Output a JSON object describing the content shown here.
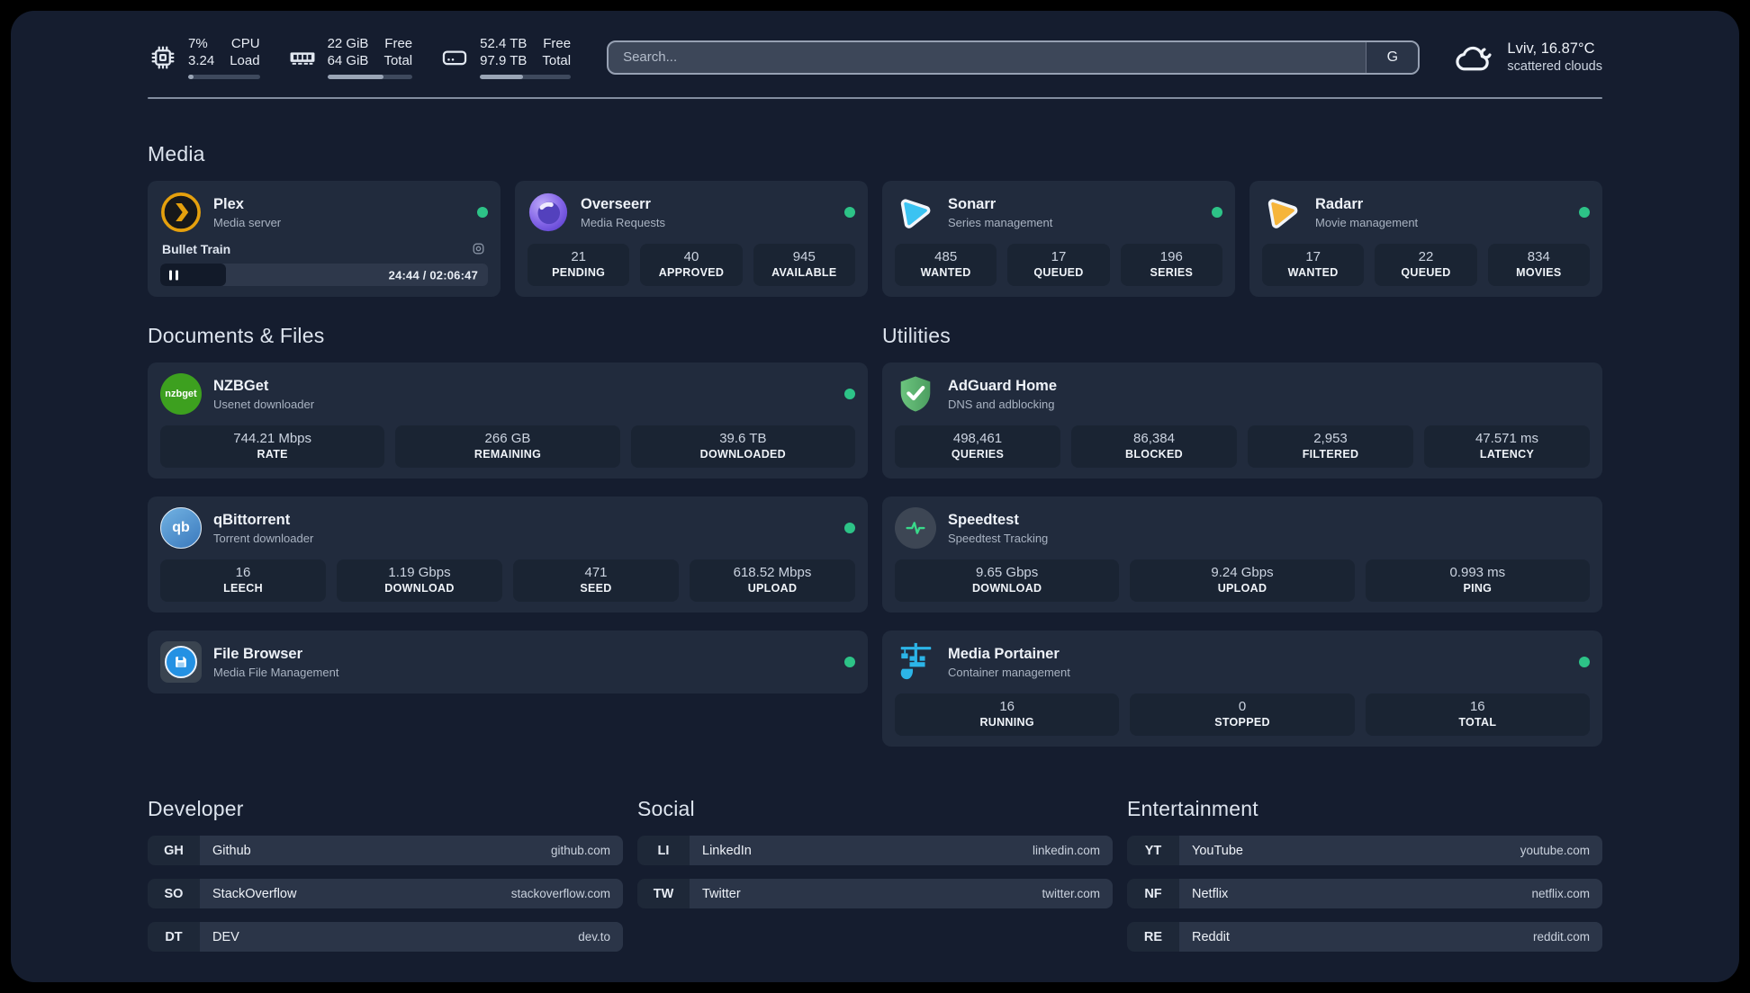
{
  "colors": {
    "status_online": "#2dc387",
    "accent_plex": "#e5a00d",
    "accent_overseerr": "#7c5ce0",
    "accent_sonarr": "#3bc3f2",
    "accent_radarr": "#f6b53b",
    "accent_nzbget": "#3da01f",
    "accent_qbittorrent": "#3a79bd",
    "accent_filebrowser": "#2491e3",
    "accent_adguard": "#5fba6e",
    "accent_speedtest": "#39d98a",
    "accent_portainer": "#2cb5e8"
  },
  "header": {
    "system_stats": [
      {
        "icon": "cpu-icon",
        "values": [
          "7%",
          "3.24"
        ],
        "labels": [
          "CPU",
          "Load"
        ],
        "progress_percent": 7
      },
      {
        "icon": "ram-icon",
        "values": [
          "22 GiB",
          "64 GiB"
        ],
        "labels": [
          "Free",
          "Total"
        ],
        "progress_percent": 66
      },
      {
        "icon": "disk-icon",
        "values": [
          "52.4 TB",
          "97.9 TB"
        ],
        "labels": [
          "Free",
          "Total"
        ],
        "progress_percent": 47
      }
    ],
    "search": {
      "placeholder": "Search...",
      "button_label": "G"
    },
    "weather": {
      "line1": "Lviv, 16.87°C",
      "line2": "scattered clouds"
    }
  },
  "icon_labels": {
    "nzbget": "nzbget",
    "qbittorrent": "qb"
  },
  "sections": {
    "media": {
      "title": "Media",
      "plex": {
        "name": "Plex",
        "description": "Media server",
        "online": true,
        "player": {
          "title": "Bullet Train",
          "time": "24:44 / 02:06:47",
          "progress_percent": 20
        }
      },
      "overseerr": {
        "name": "Overseerr",
        "description": "Media Requests",
        "online": true,
        "stats": [
          {
            "value": "21",
            "label": "PENDING"
          },
          {
            "value": "40",
            "label": "APPROVED"
          },
          {
            "value": "945",
            "label": "AVAILABLE"
          }
        ]
      },
      "sonarr": {
        "name": "Sonarr",
        "description": "Series management",
        "online": true,
        "stats": [
          {
            "value": "485",
            "label": "WANTED"
          },
          {
            "value": "17",
            "label": "QUEUED"
          },
          {
            "value": "196",
            "label": "SERIES"
          }
        ]
      },
      "radarr": {
        "name": "Radarr",
        "description": "Movie management",
        "online": true,
        "stats": [
          {
            "value": "17",
            "label": "WANTED"
          },
          {
            "value": "22",
            "label": "QUEUED"
          },
          {
            "value": "834",
            "label": "MOVIES"
          }
        ]
      }
    },
    "documents": {
      "title": "Documents & Files",
      "nzbget": {
        "name": "NZBGet",
        "description": "Usenet downloader",
        "online": true,
        "stats": [
          {
            "value": "744.21 Mbps",
            "label": "RATE"
          },
          {
            "value": "266 GB",
            "label": "REMAINING"
          },
          {
            "value": "39.6 TB",
            "label": "DOWNLOADED"
          }
        ]
      },
      "qbittorrent": {
        "name": "qBittorrent",
        "description": "Torrent downloader",
        "online": true,
        "stats": [
          {
            "value": "16",
            "label": "LEECH"
          },
          {
            "value": "1.19 Gbps",
            "label": "DOWNLOAD"
          },
          {
            "value": "471",
            "label": "SEED"
          },
          {
            "value": "618.52 Mbps",
            "label": "UPLOAD"
          }
        ]
      },
      "filebrowser": {
        "name": "File Browser",
        "description": "Media File Management",
        "online": true
      }
    },
    "utilities": {
      "title": "Utilities",
      "adguard": {
        "name": "AdGuard Home",
        "description": "DNS and adblocking",
        "stats": [
          {
            "value": "498,461",
            "label": "QUERIES"
          },
          {
            "value": "86,384",
            "label": "BLOCKED"
          },
          {
            "value": "2,953",
            "label": "FILTERED"
          },
          {
            "value": "47.571 ms",
            "label": "LATENCY"
          }
        ]
      },
      "speedtest": {
        "name": "Speedtest",
        "description": "Speedtest Tracking",
        "stats": [
          {
            "value": "9.65 Gbps",
            "label": "DOWNLOAD"
          },
          {
            "value": "9.24 Gbps",
            "label": "UPLOAD"
          },
          {
            "value": "0.993 ms",
            "label": "PING"
          }
        ]
      },
      "portainer": {
        "name": "Media Portainer",
        "description": "Container management",
        "online": true,
        "stats": [
          {
            "value": "16",
            "label": "RUNNING"
          },
          {
            "value": "0",
            "label": "STOPPED"
          },
          {
            "value": "16",
            "label": "TOTAL"
          }
        ]
      }
    },
    "developer": {
      "title": "Developer",
      "links": [
        {
          "tag": "GH",
          "name": "Github",
          "url": "github.com"
        },
        {
          "tag": "SO",
          "name": "StackOverflow",
          "url": "stackoverflow.com"
        },
        {
          "tag": "DT",
          "name": "DEV",
          "url": "dev.to"
        }
      ]
    },
    "social": {
      "title": "Social",
      "links": [
        {
          "tag": "LI",
          "name": "LinkedIn",
          "url": "linkedin.com"
        },
        {
          "tag": "TW",
          "name": "Twitter",
          "url": "twitter.com"
        }
      ]
    },
    "entertainment": {
      "title": "Entertainment",
      "links": [
        {
          "tag": "YT",
          "name": "YouTube",
          "url": "youtube.com"
        },
        {
          "tag": "NF",
          "name": "Netflix",
          "url": "netflix.com"
        },
        {
          "tag": "RE",
          "name": "Reddit",
          "url": "reddit.com"
        }
      ]
    }
  }
}
